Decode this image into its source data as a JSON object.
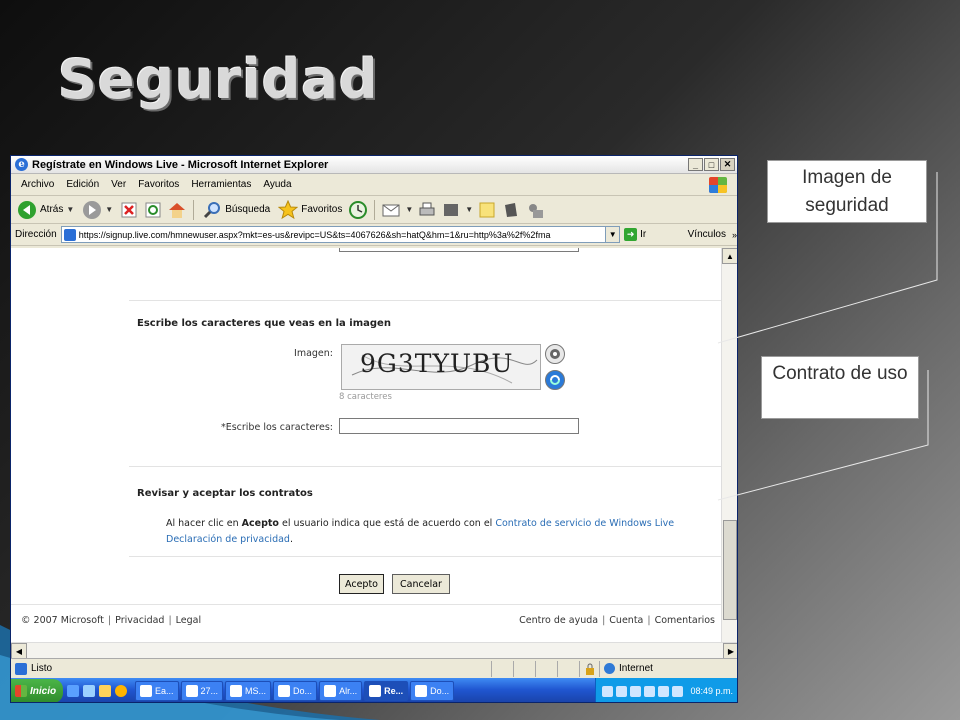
{
  "slide": {
    "title": "Seguridad",
    "callouts": [
      {
        "label": "Imagen de seguridad"
      },
      {
        "label": "Contrato de uso"
      }
    ]
  },
  "browser": {
    "window_title": "Regístrate en Windows Live - Microsoft Internet Explorer",
    "window_buttons": [
      "_",
      "□",
      "✕"
    ],
    "menu": [
      "Archivo",
      "Edición",
      "Ver",
      "Favoritos",
      "Herramientas",
      "Ayuda"
    ],
    "toolbar": {
      "back_label": "Atrás",
      "search_label": "Búsqueda",
      "favorites_label": "Favoritos"
    },
    "address": {
      "label": "Dirección",
      "url": "https://signup.live.com/hmnewuser.aspx?mkt=es-us&revipc=US&ts=4067626&sh=hatQ&hm=1&ru=http%3a%2f%2fma",
      "go_label": "Ir",
      "links_label": "Vínculos"
    },
    "status": {
      "text": "Listo",
      "zone": "Internet"
    }
  },
  "page": {
    "captcha_section_title": "Escribe los caracteres que veas en la imagen",
    "image_label": "Imagen:",
    "captcha_text": "9G3TYUBU",
    "captcha_hint": "8 caracteres",
    "input_label": "*Escribe los caracteres:",
    "contracts_title": "Revisar y aceptar los contratos",
    "agreement": {
      "prefix": "Al hacer clic en",
      "accept_word": "Acepto",
      "middle": "el usuario indica que está de acuerdo con el",
      "link1": "Contrato de servicio de Windows Live",
      "link2": "Declaración de privacidad",
      "end": "."
    },
    "accept_button": "Acepto",
    "cancel_button": "Cancelar",
    "footer": {
      "copyright": "© 2007 Microsoft",
      "privacy": "Privacidad",
      "legal": "Legal",
      "help": "Centro de ayuda",
      "account": "Cuenta",
      "comments": "Comentarios"
    }
  },
  "taskbar": {
    "start_label": "Inicio",
    "tasks": [
      "Ea...",
      "27...",
      "MS...",
      "Do...",
      "Alr...",
      "Re...",
      "Do..."
    ],
    "clock": "08:49 p.m."
  },
  "colors": {
    "link": "#2a6db5",
    "taskbar_blue": "#2056d0",
    "start_green": "#3a9b35"
  }
}
